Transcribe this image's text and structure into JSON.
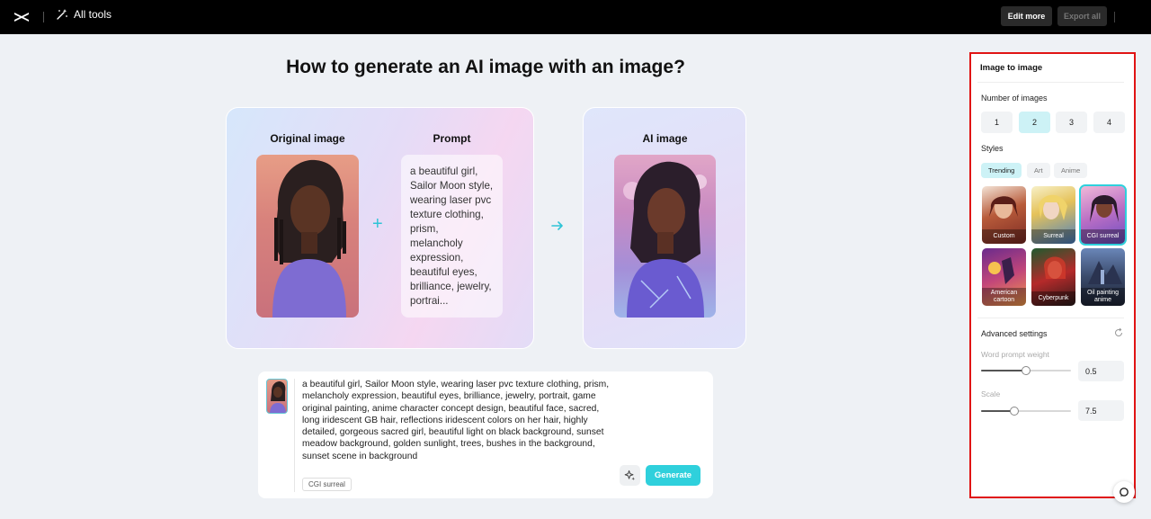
{
  "topbar": {
    "all_tools_label": "All tools",
    "edit_more_label": "Edit more",
    "export_all_label": "Export all"
  },
  "main": {
    "headline": "How to generate an AI image with an image?",
    "original_label": "Original image",
    "prompt_label": "Prompt",
    "ai_label": "AI image",
    "prompt_preview": "a beautiful girl, Sailor Moon style, wearing laser pvc texture clothing, prism, melancholy expression, beautiful eyes, brilliance, jewelry, portrai..."
  },
  "input": {
    "text": "a beautiful girl, Sailor Moon style, wearing laser pvc texture clothing, prism, melancholy expression, beautiful eyes, brilliance, jewelry, portrait, game original painting, anime character concept design, beautiful face, sacred, long iridescent GB hair, reflections iridescent colors on her hair, highly detailed, gorgeous sacred girl, beautiful light on black background, sunset meadow background, golden sunlight, trees, bushes in the background, sunset scene in background",
    "style_tag": "CGI surreal",
    "generate_label": "Generate"
  },
  "panel": {
    "title": "Image to image",
    "num_images_label": "Number of images",
    "num_options": [
      "1",
      "2",
      "3",
      "4"
    ],
    "num_selected": "2",
    "styles_label": "Styles",
    "tabs": [
      "Trending",
      "Art",
      "Anime"
    ],
    "tab_selected": "Trending",
    "styles": [
      "Custom",
      "Surreal",
      "CGI surreal",
      "American cartoon",
      "Cyberpunk",
      "Oil painting anime"
    ],
    "style_selected": "CGI surreal",
    "advanced_label": "Advanced settings",
    "word_weight_label": "Word prompt weight",
    "word_weight_value": "0.5",
    "word_weight_fraction": 0.5,
    "scale_label": "Scale",
    "scale_value": "7.5",
    "scale_fraction": 0.37
  },
  "colors": {
    "accent": "#2fd0dc",
    "highlight_frame": "#e01414"
  }
}
